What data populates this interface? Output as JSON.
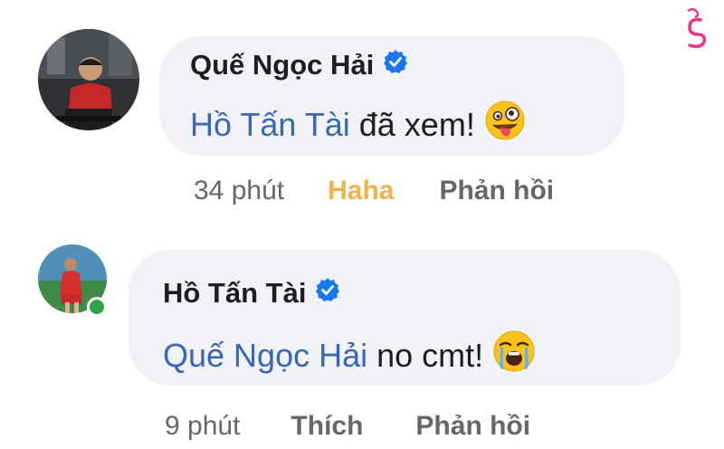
{
  "comments": [
    {
      "author": "Quế Ngọc Hải",
      "mention": "Hồ Tấn Tài",
      "text": "đã xem!",
      "emoji": "zany-face-emoji",
      "time": "34 phút",
      "reaction_label": "Haha",
      "reply_label": "Phản hồi"
    },
    {
      "author": "Hồ Tấn Tài",
      "mention": "Quế Ngọc Hải",
      "text": "no cmt!",
      "emoji": "crying-face-emoji",
      "time": "9 phút",
      "reaction_label": "Thích",
      "reply_label": "Phản hồi"
    }
  ],
  "colors": {
    "mention": "#3a66b4",
    "haha": "#f2b24a",
    "verified": "#1877f2",
    "online": "#31a24c",
    "bubble": "#f0f2f5"
  }
}
